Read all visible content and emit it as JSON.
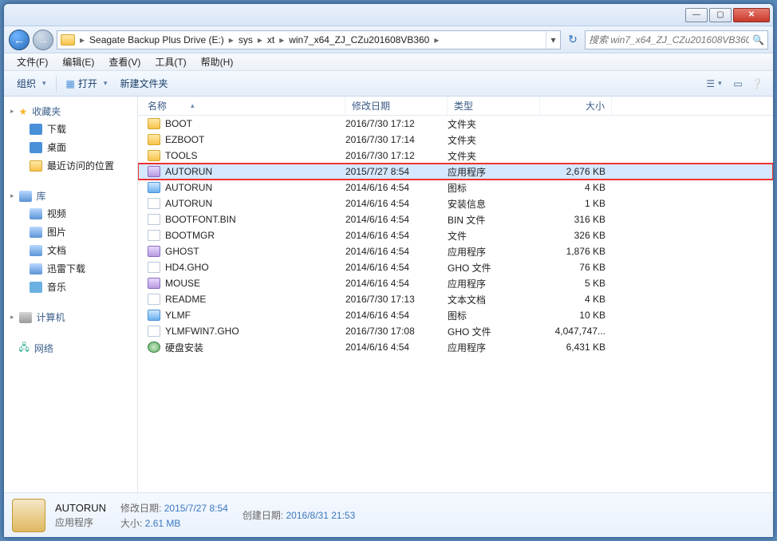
{
  "breadcrumb": [
    "Seagate Backup Plus Drive (E:)",
    "sys",
    "xt",
    "win7_x64_ZJ_CZu201608VB360"
  ],
  "search_placeholder": "搜索 win7_x64_ZJ_CZu201608VB360",
  "menubar": [
    "文件(F)",
    "编辑(E)",
    "查看(V)",
    "工具(T)",
    "帮助(H)"
  ],
  "toolbar": {
    "organize": "组织",
    "open": "打开",
    "newfolder": "新建文件夹"
  },
  "columns": {
    "name": "名称",
    "date": "修改日期",
    "type": "类型",
    "size": "大小"
  },
  "sidebar": {
    "favorites": {
      "label": "收藏夹",
      "items": [
        "下载",
        "桌面",
        "最近访问的位置"
      ]
    },
    "libraries": {
      "label": "库",
      "items": [
        "视频",
        "图片",
        "文档",
        "迅雷下载",
        "音乐"
      ]
    },
    "computer": {
      "label": "计算机"
    },
    "network": {
      "label": "网络"
    }
  },
  "files": [
    {
      "name": "BOOT",
      "date": "2016/7/30 17:12",
      "type": "文件夹",
      "size": "",
      "icon": "folder"
    },
    {
      "name": "EZBOOT",
      "date": "2016/7/30 17:14",
      "type": "文件夹",
      "size": "",
      "icon": "folder"
    },
    {
      "name": "TOOLS",
      "date": "2016/7/30 17:12",
      "type": "文件夹",
      "size": "",
      "icon": "folder"
    },
    {
      "name": "AUTORUN",
      "date": "2015/7/27 8:54",
      "type": "应用程序",
      "size": "2,676 KB",
      "icon": "exe",
      "selected": true,
      "highlighted": true
    },
    {
      "name": "AUTORUN",
      "date": "2014/6/16 4:54",
      "type": "图标",
      "size": "4 KB",
      "icon": "img"
    },
    {
      "name": "AUTORUN",
      "date": "2014/6/16 4:54",
      "type": "安装信息",
      "size": "1 KB",
      "icon": "txt"
    },
    {
      "name": "BOOTFONT.BIN",
      "date": "2014/6/16 4:54",
      "type": "BIN 文件",
      "size": "316 KB",
      "icon": "file"
    },
    {
      "name": "BOOTMGR",
      "date": "2014/6/16 4:54",
      "type": "文件",
      "size": "326 KB",
      "icon": "file"
    },
    {
      "name": "GHOST",
      "date": "2014/6/16 4:54",
      "type": "应用程序",
      "size": "1,876 KB",
      "icon": "exe"
    },
    {
      "name": "HD4.GHO",
      "date": "2014/6/16 4:54",
      "type": "GHO 文件",
      "size": "76 KB",
      "icon": "gho"
    },
    {
      "name": "MOUSE",
      "date": "2014/6/16 4:54",
      "type": "应用程序",
      "size": "5 KB",
      "icon": "exe"
    },
    {
      "name": "README",
      "date": "2016/7/30 17:13",
      "type": "文本文档",
      "size": "4 KB",
      "icon": "txt"
    },
    {
      "name": "YLMF",
      "date": "2014/6/16 4:54",
      "type": "图标",
      "size": "10 KB",
      "icon": "img"
    },
    {
      "name": "YLMFWIN7.GHO",
      "date": "2016/7/30 17:08",
      "type": "GHO 文件",
      "size": "4,047,747...",
      "icon": "gho"
    },
    {
      "name": "硬盘安装",
      "date": "2014/6/16 4:54",
      "type": "应用程序",
      "size": "6,431 KB",
      "icon": "disc"
    }
  ],
  "details": {
    "name": "AUTORUN",
    "type": "应用程序",
    "mod_label": "修改日期:",
    "mod_value": "2015/7/27 8:54",
    "size_label": "大小:",
    "size_value": "2.61 MB",
    "create_label": "创建日期:",
    "create_value": "2016/8/31 21:53"
  }
}
